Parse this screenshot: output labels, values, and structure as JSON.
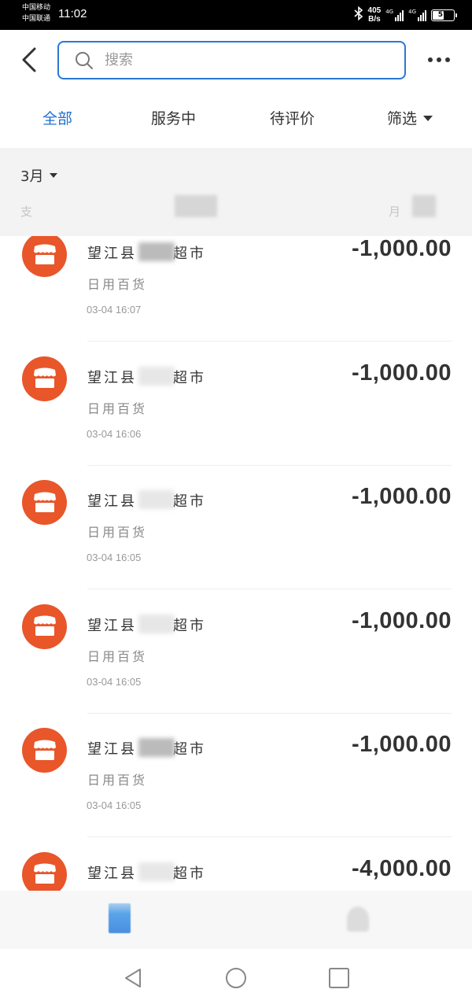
{
  "status_bar": {
    "carrier_1": "中国移动",
    "carrier_2": "中国联通",
    "time": "11:02",
    "net_speed_value": "405",
    "net_speed_unit": "B/s",
    "signal_1_tag": "4G",
    "signal_2_tag": "4G",
    "battery": "57",
    "battery_level_percent": 57,
    "icons": [
      "bluetooth-icon",
      "signal-icon",
      "battery-icon"
    ]
  },
  "header": {
    "search_placeholder": "搜索",
    "icons": [
      "back-arrow-icon",
      "search-icon",
      "more-icon"
    ]
  },
  "tabs": [
    {
      "label": "全部",
      "active": true
    },
    {
      "label": "服务中",
      "active": false
    },
    {
      "label": "待评价",
      "active": false
    },
    {
      "label": "筛选",
      "active": false
    }
  ],
  "month_bar": {
    "month": "3月",
    "summary_left": "支",
    "summary_right": "月"
  },
  "transactions": [
    {
      "merchant_prefix": "望江县",
      "merchant_suffix": "超市",
      "category": "日用百货",
      "time": "03-04  16:07",
      "amount": "-1,000.00"
    },
    {
      "merchant_prefix": "望江县",
      "merchant_suffix": "超市",
      "category": "日用百货",
      "time": "03-04  16:06",
      "amount": "-1,000.00"
    },
    {
      "merchant_prefix": "望江县",
      "merchant_suffix": "超市",
      "category": "日用百货",
      "time": "03-04  16:05",
      "amount": "-1,000.00"
    },
    {
      "merchant_prefix": "望江县",
      "merchant_suffix": "超市",
      "category": "日用百货",
      "time": "03-04  16:05",
      "amount": "-1,000.00"
    },
    {
      "merchant_prefix": "望江县",
      "merchant_suffix": "超市",
      "category": "日用百货",
      "time": "03-04  16:05",
      "amount": "-1,000.00"
    },
    {
      "merchant_prefix": "望江县",
      "merchant_suffix": "超市",
      "category": "",
      "time": "",
      "amount": "-4,000.00"
    }
  ],
  "colors": {
    "accent_blue": "#1e6fd0",
    "search_border": "#2a78d4",
    "merchant_icon_bg": "#e8562a"
  }
}
